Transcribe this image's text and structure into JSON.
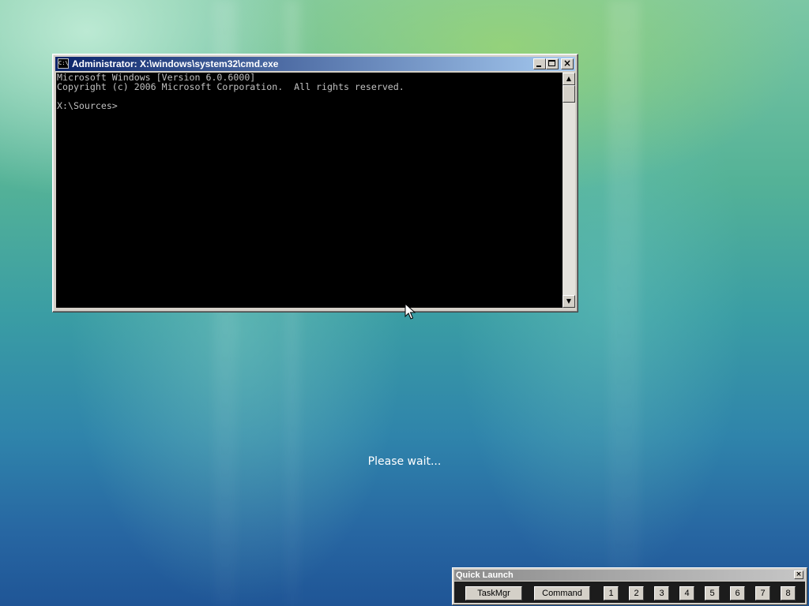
{
  "cmd": {
    "title": "Administrator: X:\\windows\\system32\\cmd.exe",
    "icon_label": "C:\\",
    "lines": [
      "Microsoft Windows [Version 6.0.6000]",
      "Copyright (c) 2006 Microsoft Corporation.  All rights reserved.",
      "",
      "X:\\Sources>"
    ],
    "buttons": {
      "close_glyph": "×"
    },
    "scroll": {
      "up_glyph": "▲",
      "down_glyph": "▼"
    }
  },
  "status": {
    "please_wait": "Please wait..."
  },
  "quick_launch": {
    "title": "Quick Launch",
    "close_glyph": "×",
    "taskmgr": "TaskMgr",
    "command": "Command",
    "numbers": [
      "1",
      "2",
      "3",
      "4",
      "5",
      "6",
      "7",
      "8"
    ]
  },
  "colors": {
    "titlebar_start": "#0a246a",
    "titlebar_end": "#a6caf0",
    "console_bg": "#000000",
    "console_text": "#c0c0c0"
  },
  "icons": {
    "cmd": "cmd-window-icon",
    "cursor": "mouse-pointer-icon"
  }
}
